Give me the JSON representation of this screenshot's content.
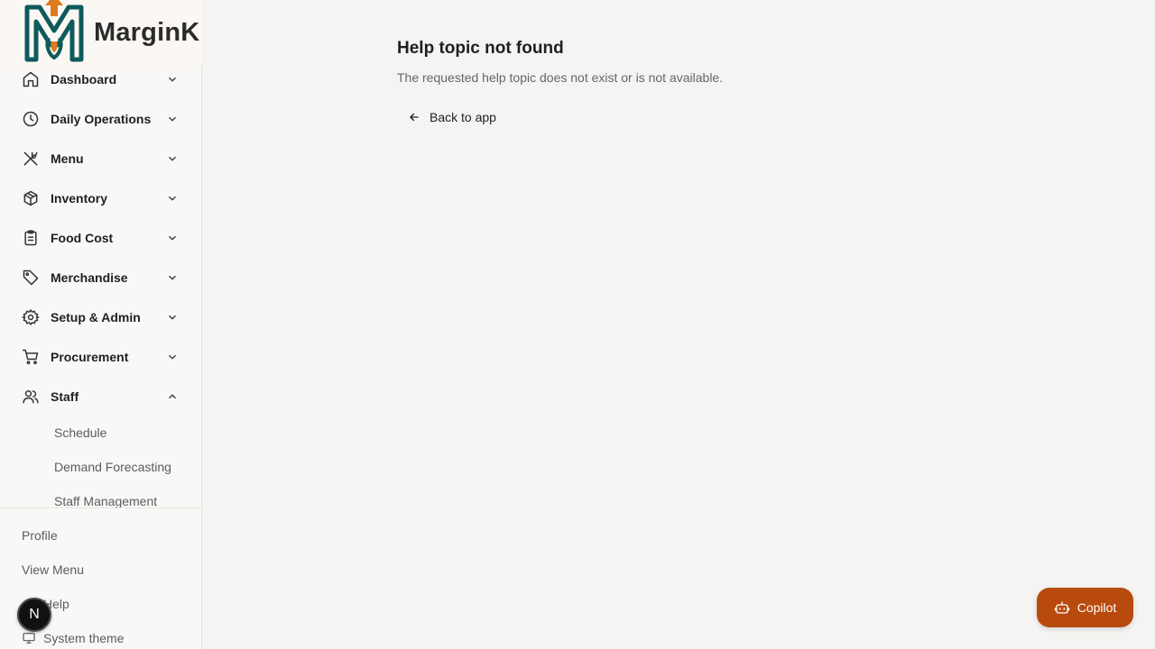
{
  "brand": {
    "name": "MarginK"
  },
  "sidebar": {
    "items": [
      {
        "label": "Dashboard",
        "icon": "home-icon",
        "expanded": false
      },
      {
        "label": "Daily Operations",
        "icon": "clock-icon",
        "expanded": false
      },
      {
        "label": "Menu",
        "icon": "utensils-icon",
        "expanded": false
      },
      {
        "label": "Inventory",
        "icon": "package-icon",
        "expanded": false
      },
      {
        "label": "Food Cost",
        "icon": "clipboard-icon",
        "expanded": false
      },
      {
        "label": "Merchandise",
        "icon": "tag-icon",
        "expanded": false
      },
      {
        "label": "Setup & Admin",
        "icon": "gear-icon",
        "expanded": false
      },
      {
        "label": "Procurement",
        "icon": "cart-icon",
        "expanded": false
      },
      {
        "label": "Staff",
        "icon": "users-icon",
        "expanded": true
      }
    ],
    "staff_subitems": [
      "Schedule",
      "Demand Forecasting",
      "Staff Management"
    ],
    "footer": {
      "profile": "Profile",
      "view_menu": "View Menu",
      "help": "Help",
      "theme": "System theme"
    },
    "avatar_initial": "N"
  },
  "main": {
    "title": "Help topic not found",
    "description": "The requested help topic does not exist or is not available.",
    "back_label": "Back to app"
  },
  "copilot": {
    "label": "Copilot",
    "color": "#b84a0e"
  },
  "colors": {
    "brand_teal": "#0f5a5c",
    "brand_orange": "#e07a1f"
  }
}
